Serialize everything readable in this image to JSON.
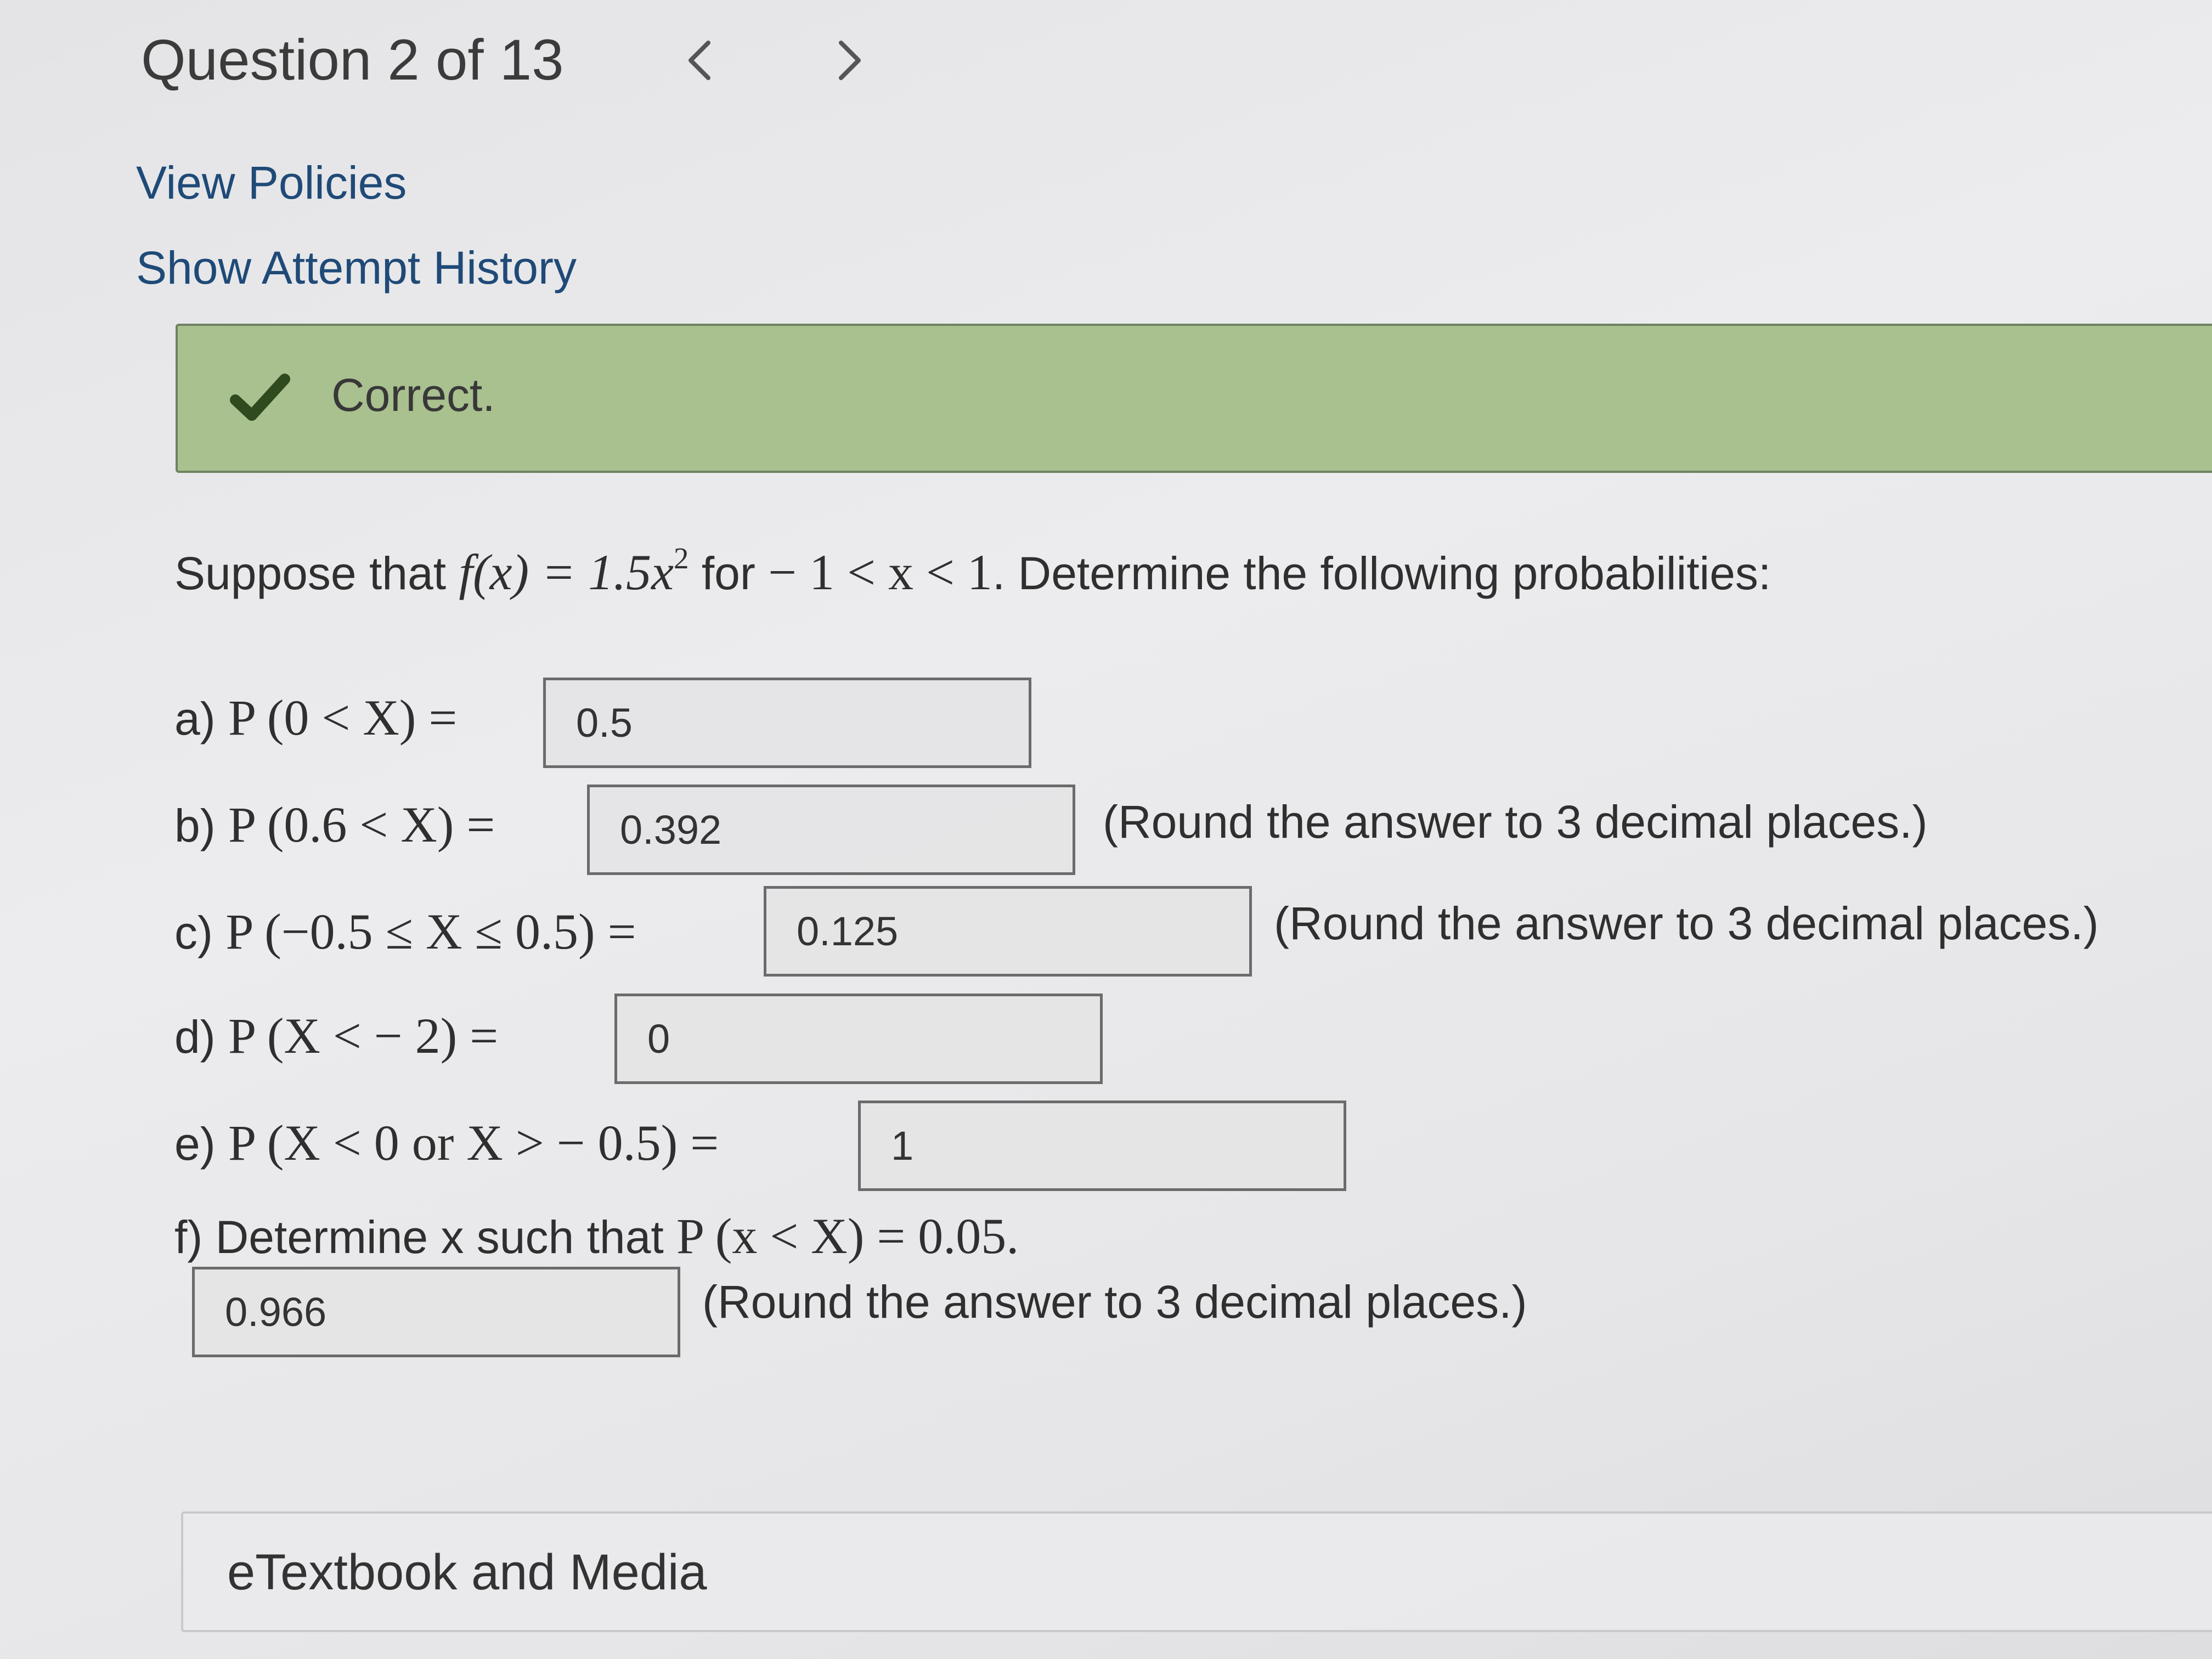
{
  "header": {
    "question_title": "Question 2 of 13",
    "prev_icon": "chevron-left-icon",
    "next_icon": "chevron-right-icon"
  },
  "links": {
    "view_policies": "View Policies",
    "show_attempt_history": "Show Attempt History"
  },
  "feedback": {
    "icon": "checkmark-icon",
    "text": "Correct.",
    "color": "#a9c08f"
  },
  "problem": {
    "intro": "Suppose that",
    "function": "f(x) = 1.5x",
    "exponent": "2",
    "for_word": "for",
    "domain": "− 1 < x < 1",
    "ending": ". Determine the following probabilities:"
  },
  "parts": [
    {
      "letter": "a)",
      "expression": "P (0 < X) =",
      "answer": "0.5",
      "note": ""
    },
    {
      "letter": "b)",
      "expression": "P (0.6 < X) =",
      "answer": "0.392",
      "note": "(Round the answer to 3 decimal places.)"
    },
    {
      "letter": "c)",
      "expression": "P (−0.5 ≤ X ≤ 0.5) =",
      "answer": "0.125",
      "note": "(Round the answer to 3 decimal places.)"
    },
    {
      "letter": "d)",
      "expression": "P (X < − 2) =",
      "answer": "0",
      "note": ""
    },
    {
      "letter": "e)",
      "expression": "P (X < 0 or X > − 0.5) =",
      "answer": "1",
      "note": ""
    }
  ],
  "part_f": {
    "text": "f) Determine x such that",
    "expression": "P (x < X) = 0.05.",
    "answer": "0.966",
    "note": "(Round the answer to 3 decimal places.)"
  },
  "etextbook": {
    "label": "eTextbook and Media"
  }
}
